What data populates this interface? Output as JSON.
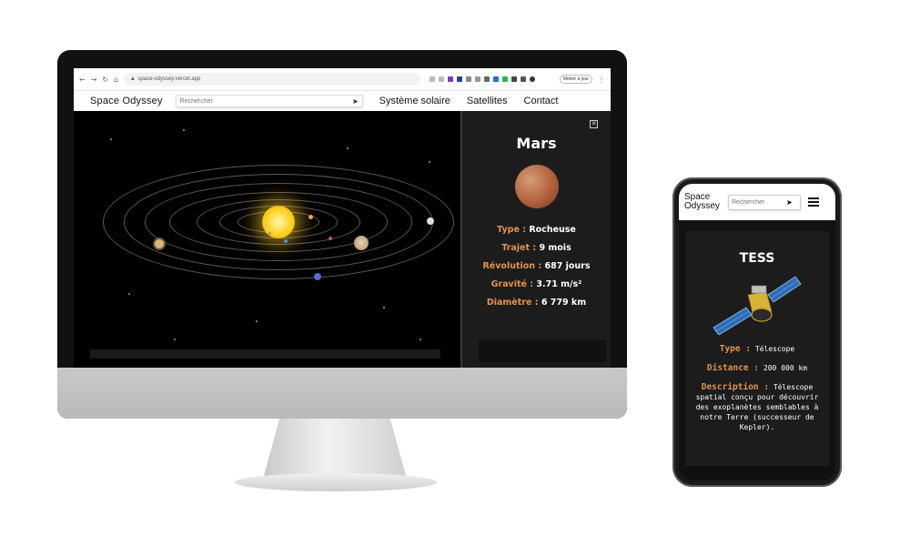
{
  "browser": {
    "url": "space-odyssey.vercel.app",
    "update_button": "Mettre à jour"
  },
  "site": {
    "brand": "Space Odyssey",
    "search_placeholder": "Rechercher",
    "nav": [
      "Système solaire",
      "Satellites",
      "Contact"
    ]
  },
  "planet_panel": {
    "name": "Mars",
    "close_icon": "close-icon",
    "fields": [
      {
        "key": "Type :",
        "value": "Rocheuse"
      },
      {
        "key": "Trajet :",
        "value": "9 mois"
      },
      {
        "key": "Révolution :",
        "value": "687 jours"
      },
      {
        "key": "Gravité :",
        "value": "3.71 m/s²"
      },
      {
        "key": "Diamètre :",
        "value": "6 779 km"
      }
    ]
  },
  "mobile": {
    "brand_line1": "Space",
    "brand_line2": "Odyssey",
    "search_placeholder": "Rechercher",
    "menu_icon": "hamburger-icon",
    "satellite": {
      "name": "TESS",
      "type_key": "Type :",
      "type_value": "Télescope",
      "distance_key": "Distance :",
      "distance_value": "200 000 km",
      "description_key": "Description :",
      "description_value": "Télescope spatial conçu pour découvrir des exoplanètes semblables à notre Terre (successeur de Kepler)."
    }
  },
  "colors": {
    "accent": "#e0934b",
    "panel_bg": "#1c1c1c",
    "space_bg": "#000000"
  }
}
